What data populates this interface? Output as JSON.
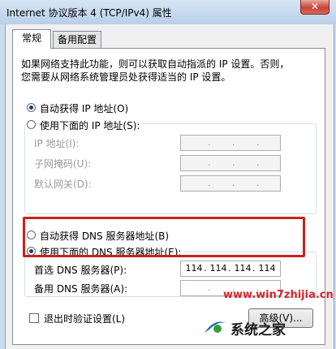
{
  "window": {
    "title": "Internet 协议版本 4 (TCP/IPv4) 属性",
    "close_glyph": "✕"
  },
  "tabs": [
    {
      "label": "常规"
    },
    {
      "label": "备用配置"
    }
  ],
  "intro": {
    "line1": "如果网络支持此功能，则可以获取自动指派的 IP 设置。否则，",
    "line2": "您需要从网络系统管理员处获得适当的 IP 设置。"
  },
  "ip": {
    "auto_label": "自动获得 IP 地址(O)",
    "manual_label": "使用下面的 IP 地址(S):",
    "address_label": "IP 地址(I):",
    "mask_label": "子网掩码(U):",
    "gateway_label": "默认网关(D):",
    "selected": "auto"
  },
  "dns": {
    "auto_label": "自动获得 DNS 服务器地址(B)",
    "manual_label": "使用下面的 DNS 服务器地址(E):",
    "preferred_label": "首选 DNS 服务器(P):",
    "preferred_octets": [
      "114",
      "114",
      "114",
      "114"
    ],
    "alternate_label": "备用 DNS 服务器(A):",
    "selected": "manual"
  },
  "validate": {
    "label": "退出时验证设置(L)",
    "checked": false
  },
  "advanced_button": "高级(V)...",
  "watermark": {
    "url": "www.win7zhijia.cn",
    "brand": "系统之家"
  },
  "colors": {
    "highlight_box": "#c8211d",
    "watermark": "#d4262b"
  }
}
